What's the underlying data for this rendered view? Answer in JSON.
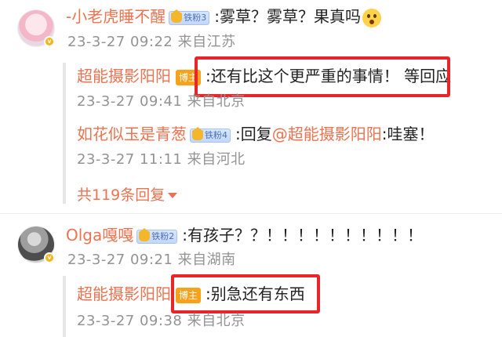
{
  "comments": [
    {
      "username": "-小老虎睡不醒",
      "fan_badge": "铁粉3",
      "content": ":雾草？雾草？果真吗",
      "emoji": "surprised-face-icon",
      "time": "23-3-27 09:22",
      "location": "来自江苏",
      "replies": [
        {
          "username": "超能摄影阳阳",
          "role_badge": "博主",
          "content": ":还有比这个更严重的事情！  等回应",
          "time": "23-3-27 09:41",
          "location": "来自北京",
          "highlighted": true
        },
        {
          "username": "如花似玉是青葱",
          "fan_badge": "铁粉4",
          "content_prefix": ":回复",
          "mention": "@超能摄影阳阳",
          "content_suffix": ":哇塞！",
          "time": "23-3-27 11:11",
          "location": "来自河北"
        }
      ],
      "more_replies": "共119条回复"
    },
    {
      "username": "Olga嘎嘎",
      "fan_badge": "铁粉2",
      "content": ":有孩子？？！！！！！！！！！！",
      "time": "23-3-27 09:21",
      "location": "来自湖南",
      "replies": [
        {
          "username": "超能摄影阳阳",
          "role_badge": "博主",
          "content": ":别急还有东西",
          "time": "23-3-27 09:38",
          "location": "来自北京",
          "highlighted": true
        }
      ]
    }
  ],
  "colors": {
    "username": "#eb7350",
    "meta": "#939393",
    "highlight_border": "#e8262a",
    "blogger_badge": "#f7a21a"
  }
}
